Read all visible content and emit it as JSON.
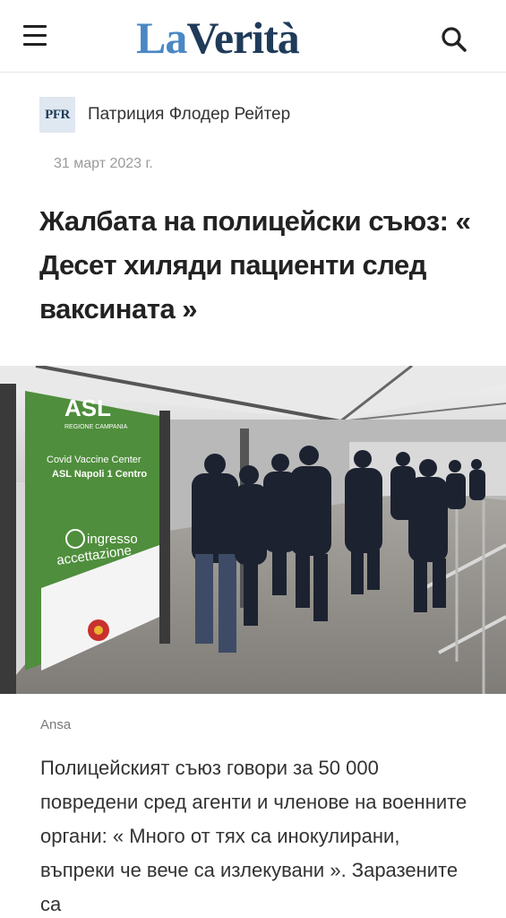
{
  "header": {
    "logo_part1": "La",
    "logo_part2": "Verità",
    "menu_icon": "hamburger-menu-icon",
    "search_icon": "search-icon"
  },
  "article": {
    "author_initials": "PFR",
    "author_name": "Патриция Флодер Рейтер",
    "date": "31 март 2023 г.",
    "headline": "Жалбата на полицейски съюз: « Десет хиляди пациенти след ваксината »",
    "photo_sign_line1": "Covid Vaccine Center",
    "photo_sign_line2": "ASL Napoli 1 Centro",
    "photo_sign_ingresso": "ingresso",
    "photo_sign_accettazione": "accettazione",
    "photo_sign_top": "ASL",
    "photo_sign_region": "REGIONE CAMPANIA",
    "photo_credit": "Ansa",
    "body": "Полицейският съюз говори за 50 000 повредени сред агенти и членове на военните органи: « Много от тях са инокулирани, въпреки че вече са излекувани ». Заразените са"
  },
  "colors": {
    "logo_la": "#4a88c4",
    "logo_verita": "#1f3b5a",
    "sign_green": "#4f8e3c"
  }
}
